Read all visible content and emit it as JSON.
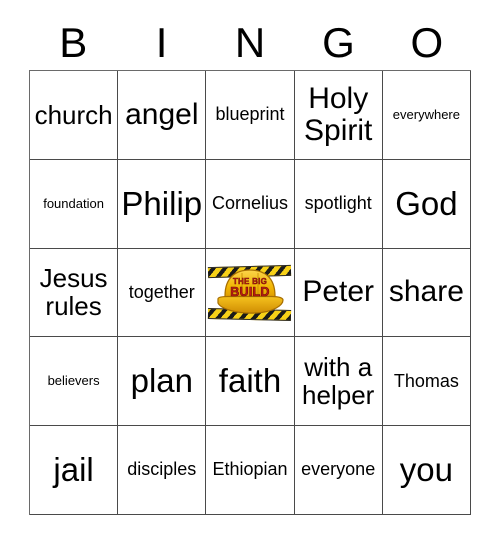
{
  "card": {
    "title": "BINGO",
    "header_letters": [
      "B",
      "I",
      "N",
      "G",
      "O"
    ],
    "columns": 5,
    "rows": 5,
    "border_color": "#4a4a4a",
    "background_color": "#ffffff",
    "text_color": "#000000"
  },
  "grid": {
    "rows": [
      [
        {
          "text": "church",
          "size": "lg"
        },
        {
          "text": "angel",
          "size": "xl"
        },
        {
          "text": "blueprint",
          "size": "md"
        },
        {
          "text": "Holy Spirit",
          "size": "xl"
        },
        {
          "text": "everywhere",
          "size": "xs"
        }
      ],
      [
        {
          "text": "foundation",
          "size": "xs"
        },
        {
          "text": "Philip",
          "size": "xxl"
        },
        {
          "text": "Cornelius",
          "size": "md"
        },
        {
          "text": "spotlight",
          "size": "md"
        },
        {
          "text": "God",
          "size": "xxl"
        }
      ],
      [
        {
          "text": "Jesus rules",
          "size": "lg"
        },
        {
          "text": "together",
          "size": "md"
        },
        {
          "text": "",
          "size": "md",
          "free_space": true
        },
        {
          "text": "Peter",
          "size": "xl"
        },
        {
          "text": "share",
          "size": "xl"
        }
      ],
      [
        {
          "text": "believers",
          "size": "xs"
        },
        {
          "text": "plan",
          "size": "xxl"
        },
        {
          "text": "faith",
          "size": "xxl"
        },
        {
          "text": "with a helper",
          "size": "lg"
        },
        {
          "text": "Thomas",
          "size": "md"
        }
      ],
      [
        {
          "text": "jail",
          "size": "xxl"
        },
        {
          "text": "disciples",
          "size": "md"
        },
        {
          "text": "Ethiopian",
          "size": "md"
        },
        {
          "text": "everyone",
          "size": "md"
        },
        {
          "text": "you",
          "size": "xxl"
        }
      ]
    ]
  },
  "free_space": {
    "logo_line_1": "THE BIG",
    "logo_line_2": "BUILD",
    "logo_alt": "The Big Build hard hat logo",
    "hat_color": "#f2b705",
    "hat_shadow_color": "#d99400",
    "text_color": "#c41e14",
    "hazard_yellow": "#f7d117",
    "hazard_black": "#1a1a1a"
  }
}
